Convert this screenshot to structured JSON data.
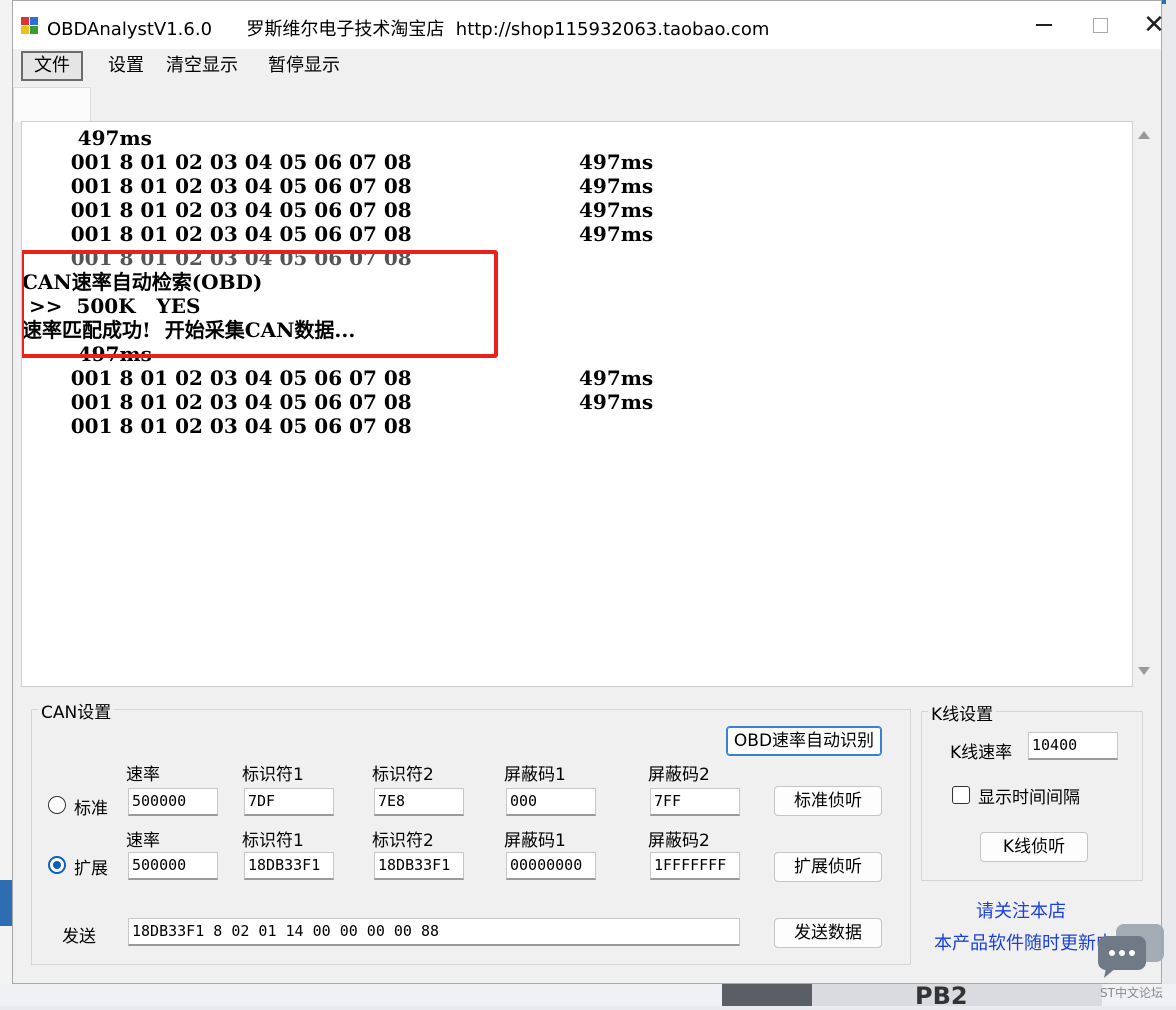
{
  "window": {
    "title": "OBDAnalystV1.6.0      罗斯维尔电子技术淘宝店  http://shop115932063.taobao.com",
    "close_glyph": "✕"
  },
  "menu": [
    "文件",
    "设置",
    "清空显示",
    "暂停显示"
  ],
  "output": {
    "lines": [
      "        497ms",
      "       001 8 01 02 03 04 05 06 07 08",
      "       001 8 01 02 03 04 05 06 07 08",
      "       001 8 01 02 03 04 05 06 07 08",
      "       001 8 01 02 03 04 05 06 07 08",
      "       001 8 01 02 03 04 05 06 07 08",
      "CAN速率自动检索(OBD)",
      " >>  500K   YES",
      "速率匹配成功!  开始采集CAN数据...",
      "        497ms",
      "       001 8 01 02 03 04 05 06 07 08",
      "       001 8 01 02 03 04 05 06 07 08",
      "       001 8 01 02 03 04 05 06 07 08"
    ],
    "timestamps": [
      "497ms",
      "497ms",
      "497ms",
      "497ms",
      "497ms",
      "497ms"
    ]
  },
  "can": {
    "group_title": "CAN设置",
    "auto_detect_button": "OBD速率自动识别",
    "col_labels": [
      "速率",
      "标识符1",
      "标识符2",
      "屏蔽码1",
      "屏蔽码2"
    ],
    "standard": {
      "label": "标准",
      "rate": "500000",
      "id1": "7DF",
      "id2": "7E8",
      "mask1": "000",
      "mask2": "7FF",
      "listen_button": "标准侦听",
      "selected": false
    },
    "extended": {
      "label": "扩展",
      "rate": "500000",
      "id1": "18DB33F1",
      "id2": "18DB33F1",
      "mask1": "00000000",
      "mask2": "1FFFFFFF",
      "listen_button": "扩展侦听",
      "selected": true
    },
    "send_label": "发送",
    "send_value": "18DB33F1 8 02 01 14 00 00 00 00 88",
    "send_button": "发送数据"
  },
  "kline": {
    "group_title": "K线设置",
    "rate_label": "K线速率",
    "rate_value": "10400",
    "show_interval_label": "显示时间间隔",
    "show_interval_checked": false,
    "listen_button": "K线侦听"
  },
  "links": {
    "follow": "请关注本店",
    "updates": "本产品软件随时更新中"
  },
  "background": {
    "taskbar_text": "PB2",
    "watermark": "ST中文论坛"
  },
  "colors": {
    "highlight": "#e8201e",
    "link": "#1a3fe0",
    "radio_selected": "#0a5fc6"
  }
}
